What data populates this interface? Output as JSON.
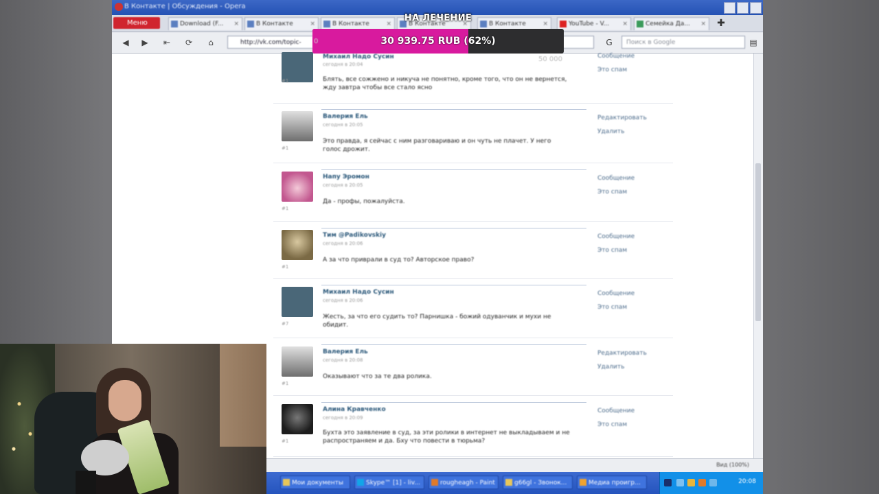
{
  "browser": {
    "title": "В Контакте | Обсуждения - Opera",
    "menu_label": "Меню",
    "tabs": [
      {
        "label": "В Контакте"
      },
      {
        "label": "Download (F..."
      },
      {
        "label": "В Контакте"
      },
      {
        "label": "В Контакте"
      },
      {
        "label": "В Контакте"
      },
      {
        "label": "В Контакте"
      },
      {
        "label": "YouTube - V..."
      },
      {
        "label": "Семейка Да..."
      }
    ],
    "url": "http://vk.com/topic-",
    "search_placeholder": "Поиск в Google",
    "zoom": "Вид (100%)"
  },
  "donation_goal": {
    "title": "НА ЛЕЧЕНИЕ",
    "amount_text": "30 939.75 RUB (62%)",
    "progress": 0.62,
    "min_label": "0",
    "max_label": "50 000",
    "fill_color": "#d81a9e"
  },
  "posts": [
    {
      "name": "Михаил Надо Сусин",
      "date": "сегодня в 20:04",
      "num": "#1",
      "text": "Блять, все сожжено и никуча не понятно, кроме того, что он не вернется, жду завтра чтобы все стало ясно",
      "actions": [
        "Сообщение",
        "Это спам"
      ],
      "avatar_color": "#4a6778"
    },
    {
      "name": "Валерия Ель",
      "date": "сегодня в 20:05",
      "num": "#1",
      "text": "Это правда, я сейчас с ним разговариваю и он чуть не плачет. У него голос дрожит.",
      "actions": [
        "Редактировать",
        "Удалить"
      ],
      "avatar_color": "#7a7a7a"
    },
    {
      "name": "Напу Эромон",
      "date": "сегодня в 20:05",
      "num": "#1",
      "text": "Да - профы, пожалуйста.",
      "actions": [
        "Сообщение",
        "Это спам"
      ],
      "avatar_color": "#c2578f"
    },
    {
      "name": "Тим @Padikovskiy",
      "date": "сегодня в 20:06",
      "num": "#1",
      "text": "А за что приврали в суд то? Авторское право?",
      "actions": [
        "Сообщение",
        "Это спам"
      ],
      "avatar_color": "#7b6a45"
    },
    {
      "name": "Михаил Надо Сусин",
      "date": "сегодня в 20:06",
      "num": "#7",
      "text": "Жесть, за что его судить то? Парнишка - божий одуванчик и мухи не обидит.",
      "actions": [
        "Сообщение",
        "Это спам"
      ],
      "avatar_color": "#4a6778"
    },
    {
      "name": "Валерия Ель",
      "date": "сегодня в 20:08",
      "num": "#1",
      "text": "Оказывают что за те два ролика.",
      "actions": [
        "Редактировать",
        "Удалить"
      ],
      "avatar_color": "#7a7a7a"
    },
    {
      "name": "Алина Кравченко",
      "date": "сегодня в 20:09",
      "num": "#1",
      "text": "Бухта это заявление в суд, за эти ролики в интернет не выкладываем и не распространяем и да. Бху что повести в тюрьма?",
      "actions": [
        "Сообщение",
        "Это спам"
      ],
      "avatar_color": "#2a2a2a"
    }
  ],
  "taskbar": {
    "items": [
      {
        "label": "Мои документы"
      },
      {
        "label": "Skype™ [1] - liv..."
      },
      {
        "label": "rougheagh - Paint"
      },
      {
        "label": "g66gl - Звонок..."
      },
      {
        "label": "Медиа проигр..."
      }
    ],
    "clock": "20:08"
  }
}
